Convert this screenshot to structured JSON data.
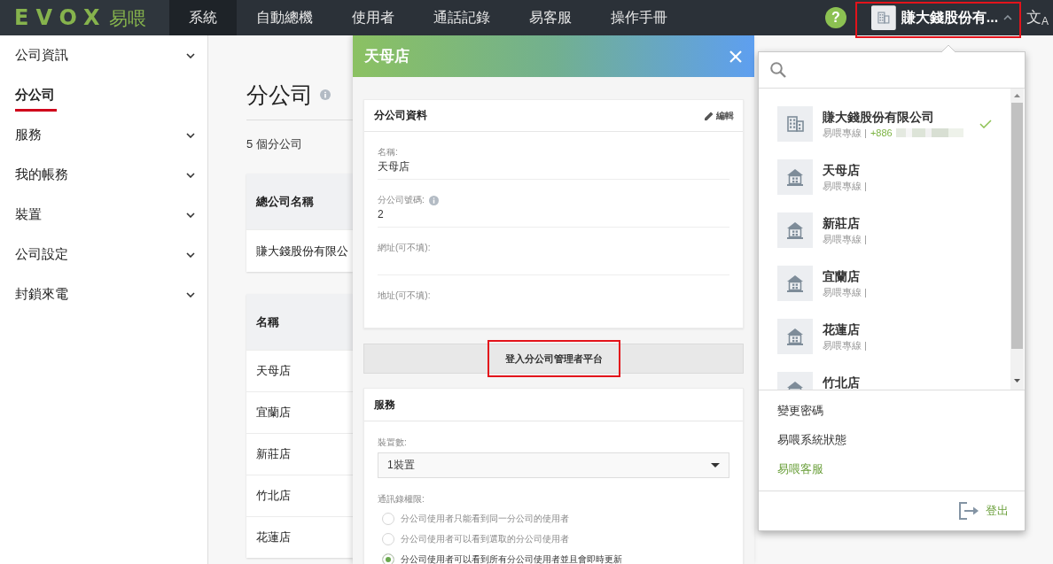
{
  "header": {
    "logo": {
      "wordmark": "EVOX",
      "name": "易喂"
    },
    "nav": [
      {
        "label": "系統",
        "selected": true
      },
      {
        "label": "自動總機",
        "selected": false
      },
      {
        "label": "使用者",
        "selected": false
      },
      {
        "label": "通話記錄",
        "selected": false
      },
      {
        "label": "易客服",
        "selected": false
      },
      {
        "label": "操作手冊",
        "selected": false
      }
    ],
    "help": "?",
    "company_switcher": {
      "label": "賺大錢股份有...",
      "highlighted": true
    },
    "language": "文$_{A}$"
  },
  "sidebar": {
    "items": [
      {
        "label": "公司資訊",
        "kind": "group",
        "selected": false
      },
      {
        "label": "分公司",
        "kind": "page",
        "selected": true
      },
      {
        "label": "服務",
        "kind": "group",
        "selected": false
      },
      {
        "label": "我的帳務",
        "kind": "group",
        "selected": false
      },
      {
        "label": "裝置",
        "kind": "group",
        "selected": false
      },
      {
        "label": "公司設定",
        "kind": "group",
        "selected": false
      },
      {
        "label": "封鎖來電",
        "kind": "group",
        "selected": false
      }
    ]
  },
  "page": {
    "title": "分公司",
    "count": "5 個分公司",
    "head_office_table": {
      "column": "總公司名稱",
      "rows": [
        "賺大錢股份有限公"
      ]
    },
    "branch_table": {
      "column": "名稱",
      "rows": [
        "天母店",
        "宜蘭店",
        "新莊店",
        "竹北店",
        "花蓮店"
      ]
    }
  },
  "branch_panel": {
    "title": "天母店",
    "info_card": {
      "title": "分公司資料",
      "edit": "編輯",
      "fields": [
        {
          "label": "名稱:",
          "value": "天母店",
          "info": false
        },
        {
          "label": "分公司號碼:",
          "value": "2",
          "info": true
        },
        {
          "label": "網址(可不填):",
          "info": false
        },
        {
          "label": "地址(可不填):",
          "info": false
        }
      ]
    },
    "login_button": {
      "label": "登入分公司管理者平台",
      "highlighted": true
    },
    "service_card": {
      "title": "服務",
      "device_label": "裝置數:",
      "device_select": {
        "value": "1裝置"
      },
      "permission_label": "通訊錄權限:",
      "permission_options": [
        {
          "label": "分公司使用者只能看到同一分公司的使用者",
          "selected": false
        },
        {
          "label": "分公司使用者可以看到選取的分公司使用者",
          "selected": false
        },
        {
          "label": "分公司使用者可以看到所有分公司使用者並且會即時更新",
          "selected": true
        }
      ]
    }
  },
  "company_menu": {
    "companies": [
      {
        "name": "賺大錢股份有限公司",
        "kind": "head_office",
        "line": "易喂專線 |",
        "phone": "+886",
        "redacted": true,
        "selected": true
      },
      {
        "name": "天母店",
        "kind": "branch",
        "line": "易喂專線 |",
        "selected": false
      },
      {
        "name": "新莊店",
        "kind": "branch",
        "line": "易喂專線 |",
        "selected": false
      },
      {
        "name": "宜蘭店",
        "kind": "branch",
        "line": "易喂專線 |",
        "selected": false
      },
      {
        "name": "花蓮店",
        "kind": "branch",
        "line": "易喂專線 |",
        "selected": false
      },
      {
        "name": "竹北店",
        "kind": "branch",
        "selected": false
      }
    ],
    "links": [
      {
        "label": "變更密碼",
        "kind": "plain"
      },
      {
        "label": "易喂系統狀態",
        "kind": "plain"
      },
      {
        "label": "易喂客服",
        "kind": "accent"
      }
    ],
    "logout": "登出"
  }
}
